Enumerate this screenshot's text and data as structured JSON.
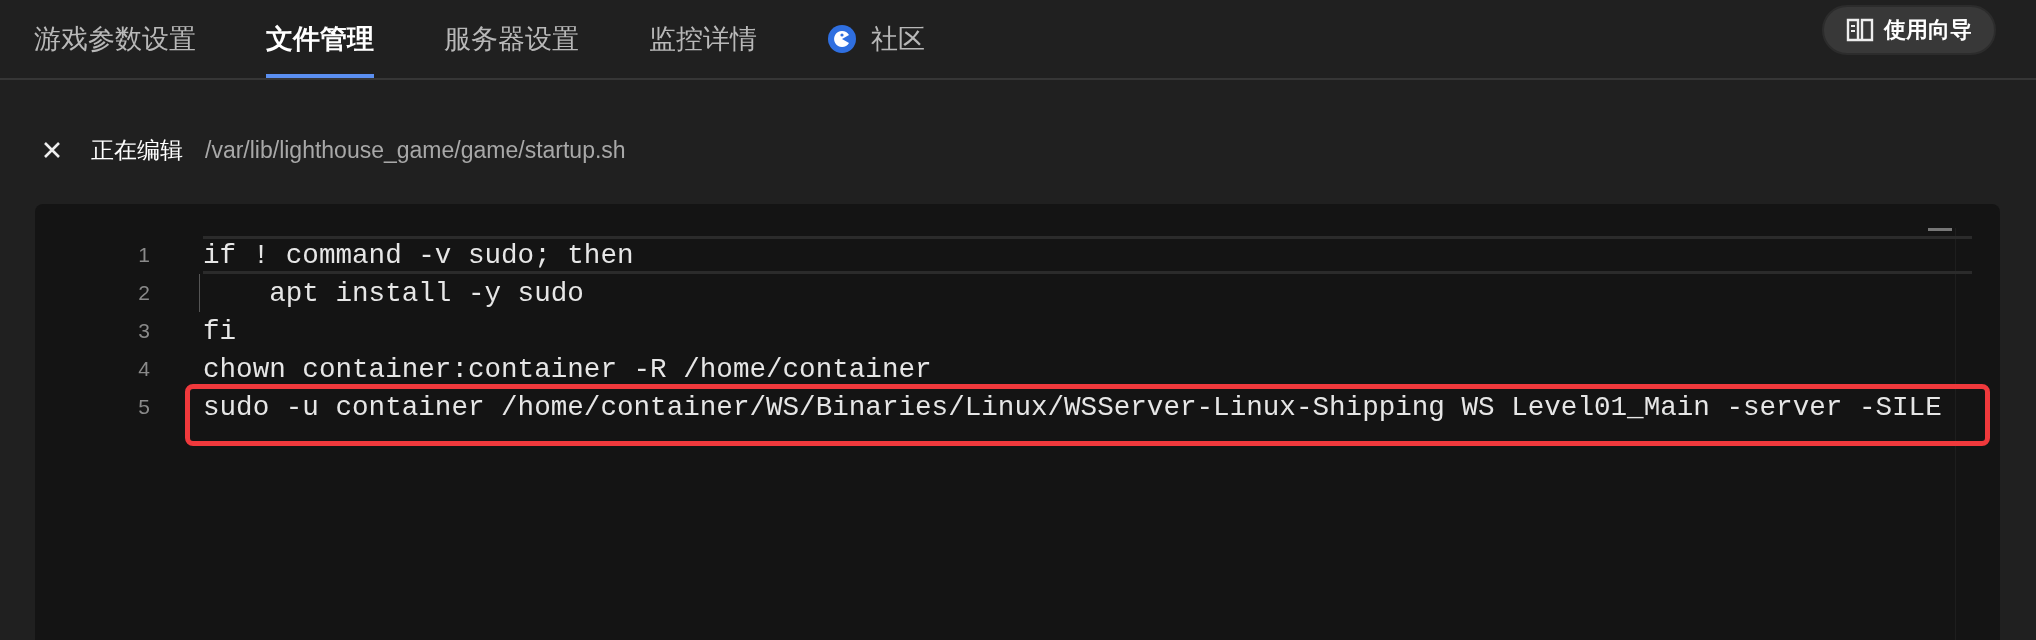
{
  "tabs": [
    {
      "label": "游戏参数设置",
      "selected": false,
      "kind": "text"
    },
    {
      "label": "文件管理",
      "selected": true,
      "kind": "text"
    },
    {
      "label": "服务器设置",
      "selected": false,
      "kind": "text"
    },
    {
      "label": "监控详情",
      "selected": false,
      "kind": "text"
    },
    {
      "label": "社区",
      "selected": false,
      "kind": "community"
    }
  ],
  "guide_button": {
    "label": "使用向导"
  },
  "editing_bar": {
    "status": "正在编辑",
    "path": "/var/lib/lighthouse_game/game/startup.sh"
  },
  "editor": {
    "lines": [
      {
        "number": "1",
        "code": "if ! command -v sudo; then",
        "current": true,
        "highlighted": false
      },
      {
        "number": "2",
        "code": "    apt install -y sudo",
        "current": false,
        "highlighted": false
      },
      {
        "number": "3",
        "code": "fi",
        "current": false,
        "highlighted": false
      },
      {
        "number": "4",
        "code": "chown container:container -R /home/container",
        "current": false,
        "highlighted": false
      },
      {
        "number": "5",
        "code": "sudo -u container /home/container/WS/Binaries/Linux/WSServer-Linux-Shipping WS Level01_Main -server -SILE",
        "current": false,
        "highlighted": true
      }
    ]
  }
}
